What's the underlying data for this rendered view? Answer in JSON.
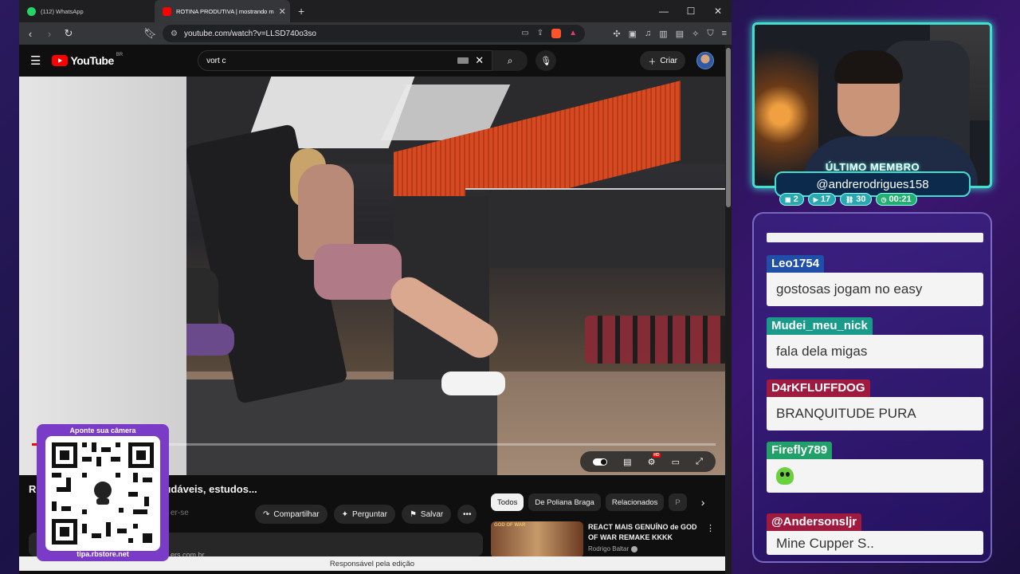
{
  "browser": {
    "tabs": [
      {
        "title": "(112) WhatsApp",
        "icon": "whatsapp-icon",
        "color": "#25d366"
      },
      {
        "title": "ROTINA PRODUTIVA | mostrando m",
        "icon": "youtube-icon",
        "color": "#ff0000"
      }
    ],
    "new_tab": "+",
    "window_controls": [
      "—",
      "☐",
      "✕"
    ],
    "url": "youtube.com/watch?v=LLSD740o3so"
  },
  "youtube": {
    "logo_text": "YouTube",
    "country": "BR",
    "search_value": "vort c",
    "create_label": "Criar",
    "video_title": "Ro… ando meus hábitos saudáveis, estudos...",
    "subscribe_faded": "er-se",
    "actions": {
      "share": "Compartilhar",
      "ask": "Perguntar",
      "save": "Salvar"
    },
    "desc_link": "ers.com.br",
    "chips": [
      "Todos",
      "De Poliana Braga",
      "Relacionados",
      "P"
    ],
    "recommended": {
      "thumb_text": "GOD OF WAR",
      "title": "REACT MAIS GENUÍNO de GOD OF WAR REMAKE KKKK",
      "channel": "Rodrigo Baltar"
    },
    "status_text": "Responsável pela edição",
    "progress_fraction": 0.02
  },
  "overlay": {
    "qr_header": "Aponte sua câmera",
    "qr_footer": "tipa.rbstore.net",
    "member_label": "ÚLTIMO MEMBRO",
    "member_name": "@andrerodrigues158",
    "stats": [
      {
        "icon": "chat-icon",
        "value": "2"
      },
      {
        "icon": "youtube-icon",
        "value": "17"
      },
      {
        "icon": "link-icon",
        "value": "30"
      },
      {
        "icon": "clock-icon",
        "value": "00:21"
      }
    ]
  },
  "chat": [
    {
      "user": "Leo1754",
      "color": "#1f4fa8",
      "text": "gostosas jogam no easy"
    },
    {
      "user": "Mudei_meu_nick",
      "color": "#1a9a8a",
      "text": "fala dela migas"
    },
    {
      "user": "D4rKFLUFFDOG",
      "color": "#a01a40",
      "text": "BRANQUITUDE PURA"
    },
    {
      "user": "Firefly789",
      "color": "#22a06a",
      "text": ""
    },
    {
      "user": "@Andersonsljr",
      "color": "#a01a40",
      "text": "Mine Cupper S.."
    }
  ]
}
